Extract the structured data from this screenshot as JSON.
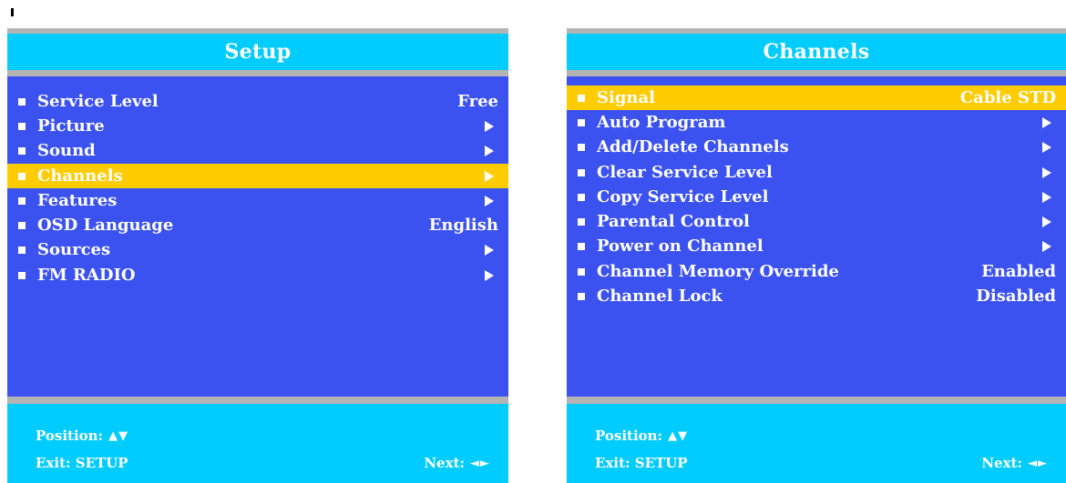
{
  "setup": {
    "title": "Setup",
    "items": [
      {
        "label": "Service Level",
        "value": "Free",
        "arrow": false,
        "selected": false
      },
      {
        "label": "Picture",
        "value": "",
        "arrow": true,
        "selected": false
      },
      {
        "label": "Sound",
        "value": "",
        "arrow": true,
        "selected": false
      },
      {
        "label": "Channels",
        "value": "",
        "arrow": true,
        "selected": true
      },
      {
        "label": "Features",
        "value": "",
        "arrow": true,
        "selected": false
      },
      {
        "label": "OSD Language",
        "value": "English",
        "arrow": false,
        "selected": false
      },
      {
        "label": "Sources",
        "value": "",
        "arrow": true,
        "selected": false
      },
      {
        "label": "FM RADIO",
        "value": "",
        "arrow": true,
        "selected": false
      }
    ],
    "footer": {
      "position_label": "Position:",
      "position_glyphs": "▲▼",
      "exit_label": "Exit: SETUP",
      "next_label": "Next:",
      "next_glyphs": "◄►"
    }
  },
  "channels": {
    "title": "Channels",
    "items": [
      {
        "label": "Signal",
        "value": "Cable STD",
        "arrow": false,
        "selected": true
      },
      {
        "label": "Auto Program",
        "value": "",
        "arrow": true,
        "selected": false
      },
      {
        "label": "Add/Delete Channels",
        "value": "",
        "arrow": true,
        "selected": false
      },
      {
        "label": "Clear Service Level",
        "value": "",
        "arrow": true,
        "selected": false
      },
      {
        "label": "Copy Service Level",
        "value": "",
        "arrow": true,
        "selected": false
      },
      {
        "label": "Parental Control",
        "value": "",
        "arrow": true,
        "selected": false
      },
      {
        "label": "Power on Channel",
        "value": "",
        "arrow": true,
        "selected": false
      },
      {
        "label": "Channel Memory Override",
        "value": "Enabled",
        "arrow": false,
        "selected": false
      },
      {
        "label": "Channel Lock",
        "value": "Disabled",
        "arrow": false,
        "selected": false
      }
    ],
    "footer": {
      "position_label": "Position:",
      "position_glyphs": "▲▼",
      "exit_label": "Exit: SETUP",
      "next_label": "Next:",
      "next_glyphs": "◄►"
    }
  },
  "colors": {
    "panel_bg": "#3b52f0",
    "header_bg": "#00ccff",
    "divider": "#b4b4b4",
    "selection": "#ffcc00",
    "text": "#ffffff"
  },
  "icons": {
    "bullet": "square-bullet-icon",
    "submenu": "right-arrow-icon"
  }
}
